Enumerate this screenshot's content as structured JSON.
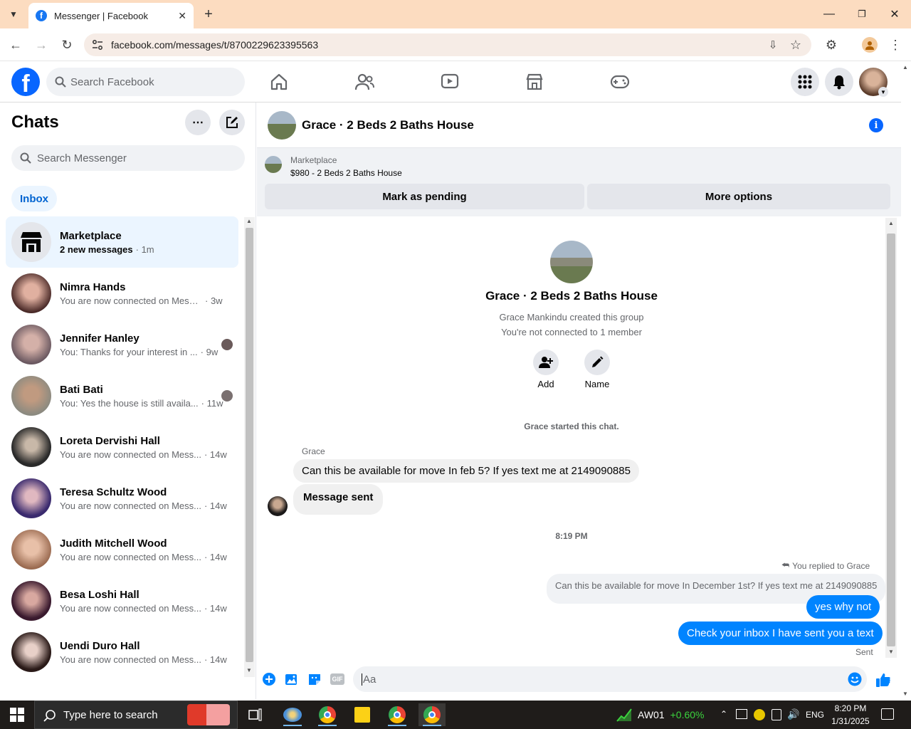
{
  "browser": {
    "tab_title": "Messenger | Facebook",
    "url": "facebook.com/messages/t/8700229623395563"
  },
  "fb": {
    "search_placeholder": "Search Facebook"
  },
  "left": {
    "title": "Chats",
    "search_placeholder": "Search Messenger",
    "filter_inbox": "Inbox",
    "chats": [
      {
        "name": "Marketplace",
        "preview": "2 new messages",
        "time": "· 1m",
        "avatar": "#e4e6eb"
      },
      {
        "name": "Nimra Hands",
        "preview": "You are now connected on Messe...",
        "time": "· 3w",
        "avatar": "#b07a6a"
      },
      {
        "name": "Jennifer Hanley",
        "preview": "You: Thanks for your interest in ...",
        "time": "· 9w",
        "avatar": "#7b6a70"
      },
      {
        "name": "Bati Bati",
        "preview": "You: Yes the house is still availa...",
        "time": "· 11w",
        "avatar": "#8b8a80"
      },
      {
        "name": "Loreta Dervishi Hall",
        "preview": "You are now connected on Mess...",
        "time": "· 14w",
        "avatar": "#6d6b66"
      },
      {
        "name": "Teresa Schultz Wood",
        "preview": "You are now connected on Mess...",
        "time": "· 14w",
        "avatar": "#7a5c8e"
      },
      {
        "name": "Judith Mitchell Wood",
        "preview": "You are now connected on Mess...",
        "time": "· 14w",
        "avatar": "#b08a6a"
      },
      {
        "name": "Besa Loshi Hall",
        "preview": "You are now connected on Mess...",
        "time": "· 14w",
        "avatar": "#6a4a5e"
      },
      {
        "name": "Uendi Duro Hall",
        "preview": "You are now connected on Mess...",
        "time": "· 14w",
        "avatar": "#5a4a48"
      }
    ]
  },
  "conversation": {
    "title": "Grace · 2 Beds 2 Baths House",
    "marketplace_label": "Marketplace",
    "listing": "$980 - 2 Beds 2 Baths House",
    "mark_pending": "Mark as pending",
    "more_options": "More options",
    "group_title": "Grace · 2 Beds 2 Baths House",
    "created_by": "Grace Mankindu created this group",
    "not_connected": "You're not connected to 1 member",
    "add_label": "Add",
    "name_label": "Name",
    "started": "Grace started this chat.",
    "sender_name": "Grace",
    "msg1": "Can this be available for move In feb 5? If yes text me at 2149090885",
    "msg2": "Message sent",
    "time_divider": "8:19 PM",
    "replied_to": "You replied to Grace",
    "quoted": "Can this be available for move In December 1st? If yes text me at 2149090885",
    "out1": "yes why not",
    "out2": "Check your inbox I have sent you a text",
    "status": "Sent",
    "composer_placeholder": "Aa"
  },
  "taskbar": {
    "search_placeholder": "Type here to search",
    "stock_name": "AW01",
    "stock_change": "+0.60%",
    "lang": "ENG",
    "time": "8:20 PM",
    "date": "1/31/2025"
  },
  "colors": {
    "brand": "#0866ff",
    "messenger_blue": "#0084ff",
    "tab_bar": "#fcdcc0",
    "stock_green": "#3bd23d"
  }
}
